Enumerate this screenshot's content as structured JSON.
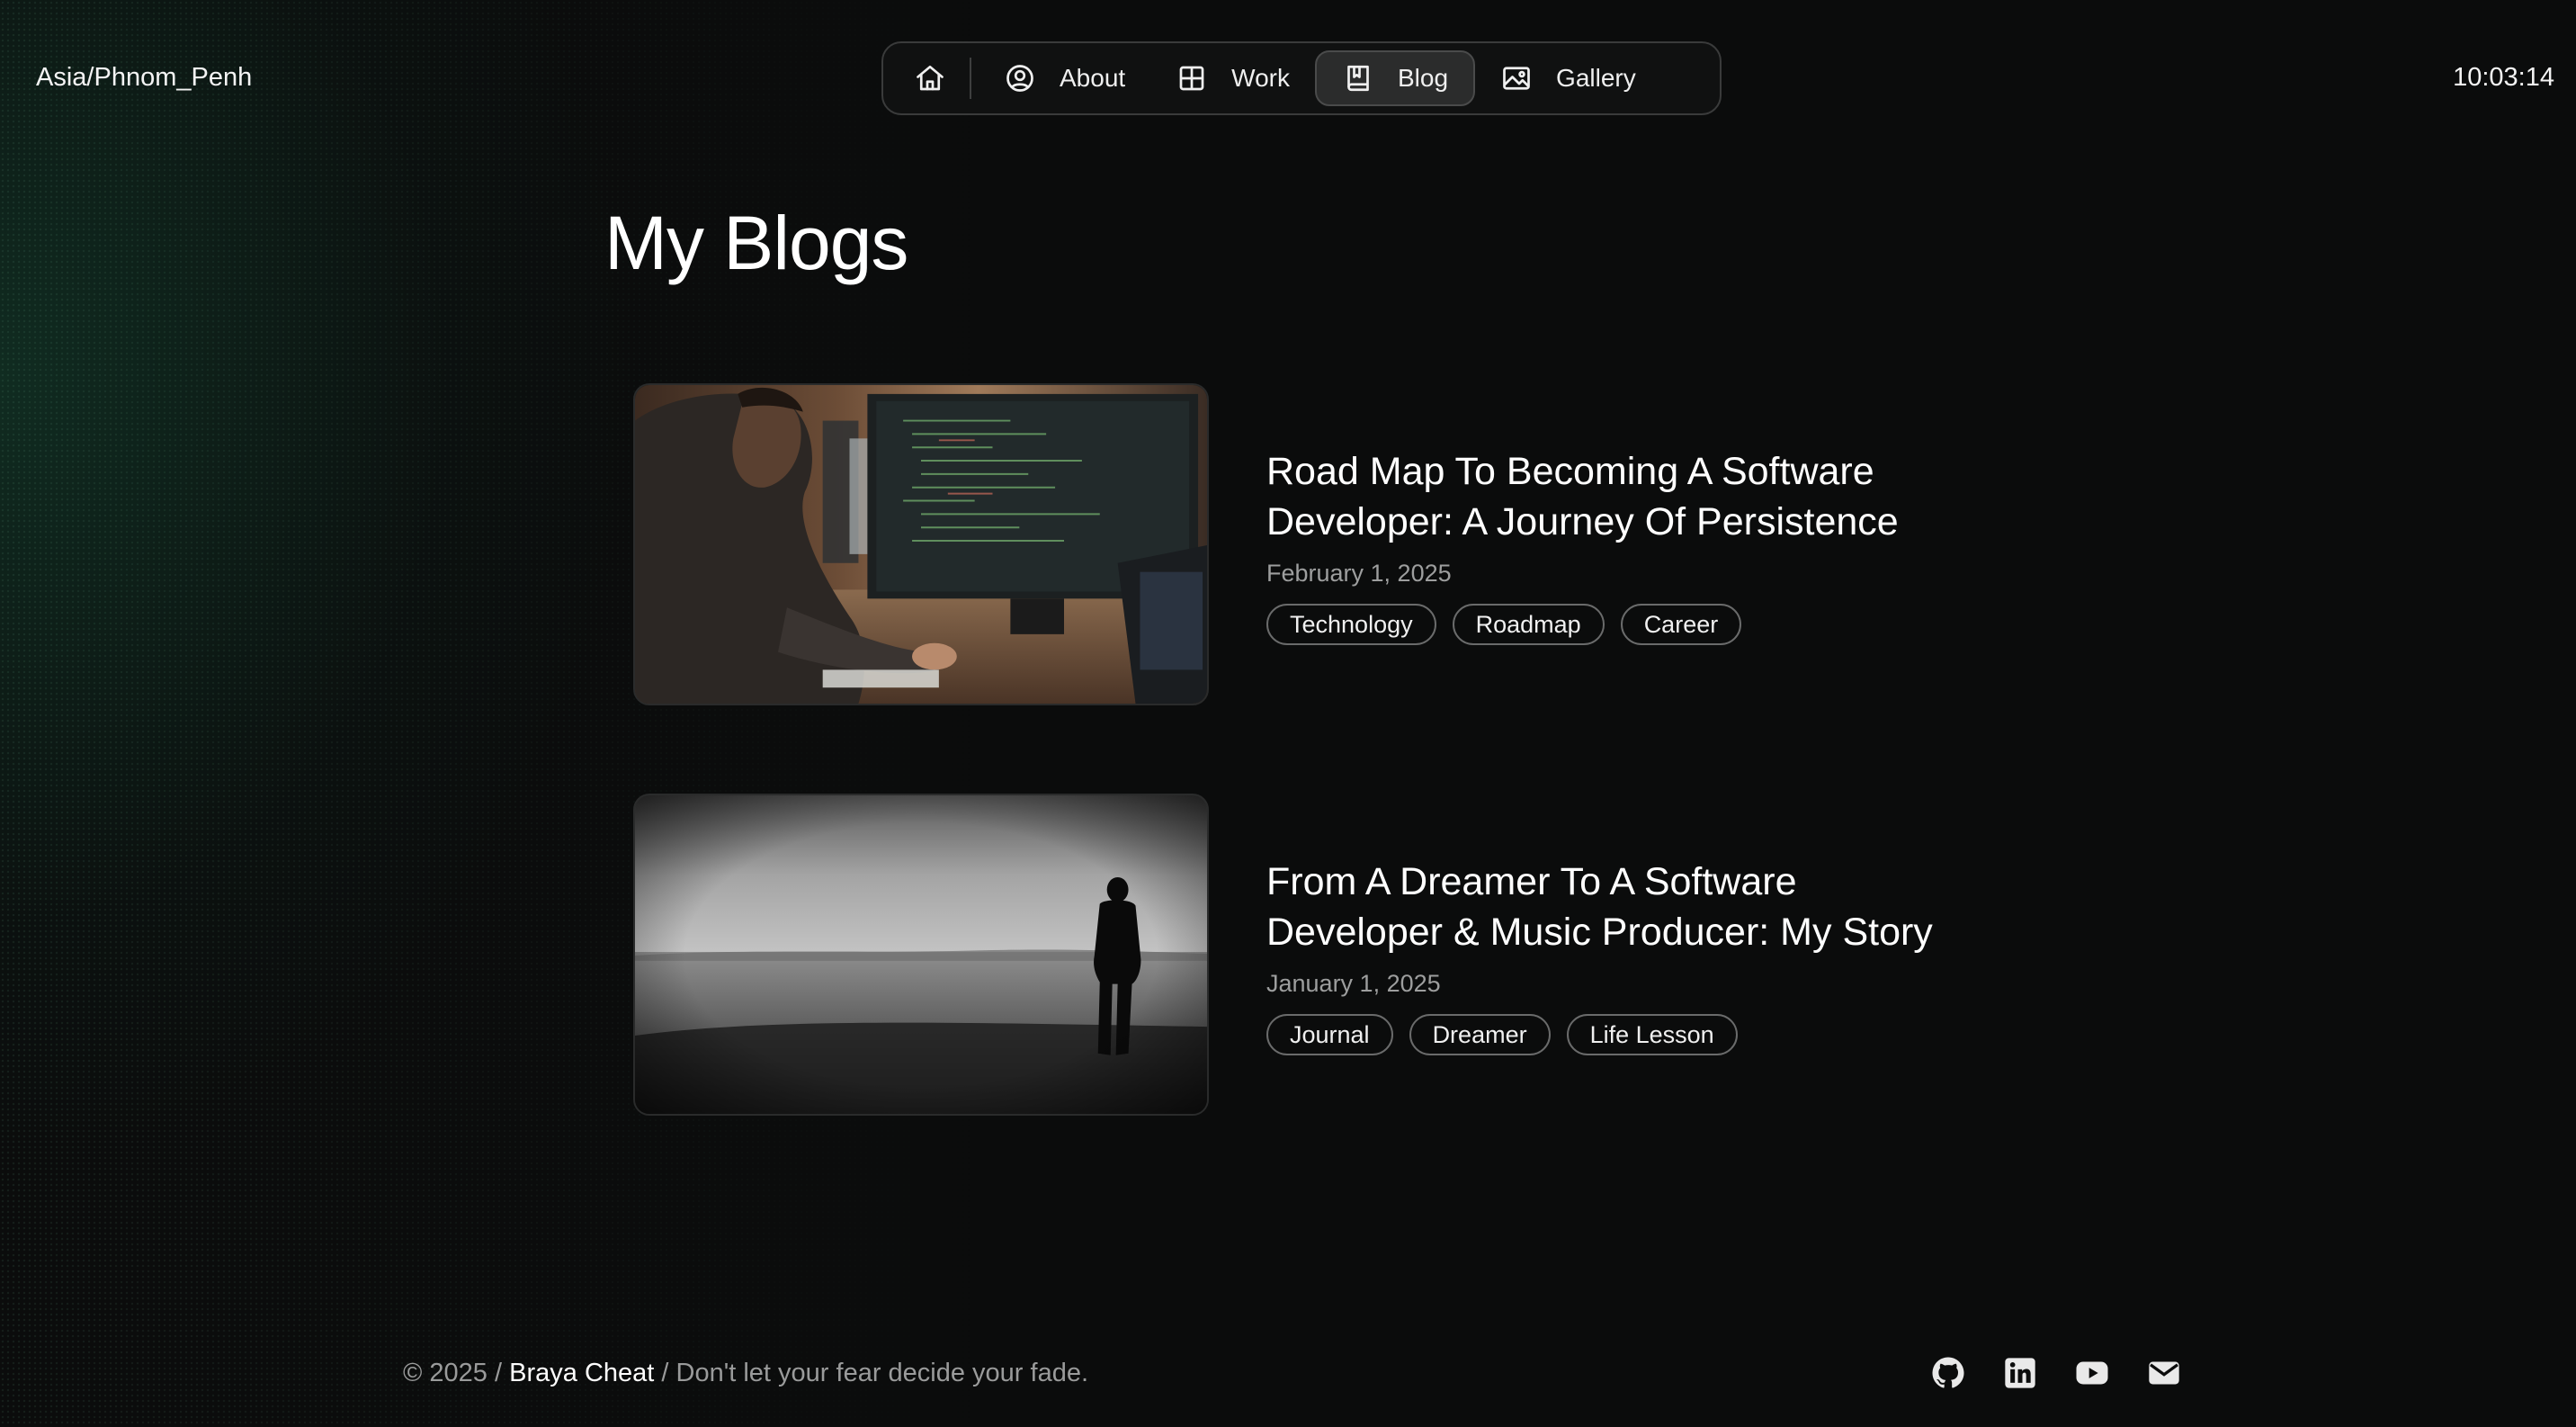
{
  "header": {
    "timezone": "Asia/Phnom_Penh",
    "clock": "10:03:14"
  },
  "nav": {
    "items": [
      {
        "label": "About",
        "icon": "user-circle-icon"
      },
      {
        "label": "Work",
        "icon": "grid-icon"
      },
      {
        "label": "Blog",
        "icon": "book-icon",
        "active": true
      },
      {
        "label": "Gallery",
        "icon": "image-icon"
      }
    ],
    "home_icon": "home-icon"
  },
  "main": {
    "title": "My Blogs",
    "posts": [
      {
        "title_line1": "Road Map To Becoming A Software",
        "title_line2": "Developer: A Journey Of Persistence",
        "date": "February 1, 2025",
        "tags": [
          "Technology",
          "Roadmap",
          "Career"
        ]
      },
      {
        "title_line1": "From A Dreamer To A Software",
        "title_line2": "Developer & Music Producer: My Story",
        "date": "January 1, 2025",
        "tags": [
          "Journal",
          "Dreamer",
          "Life Lesson"
        ]
      }
    ]
  },
  "footer": {
    "copyright": "© 2025 / ",
    "name": "Braya Cheat",
    "tagline": " / Don't let your fear decide your fade.",
    "socials": [
      "github-icon",
      "linkedin-icon",
      "youtube-icon",
      "email-icon"
    ]
  },
  "colors": {
    "background": "#0b0c0c",
    "accent_glow": "#144632",
    "text": "#ffffff",
    "muted": "#9d9e9e"
  }
}
